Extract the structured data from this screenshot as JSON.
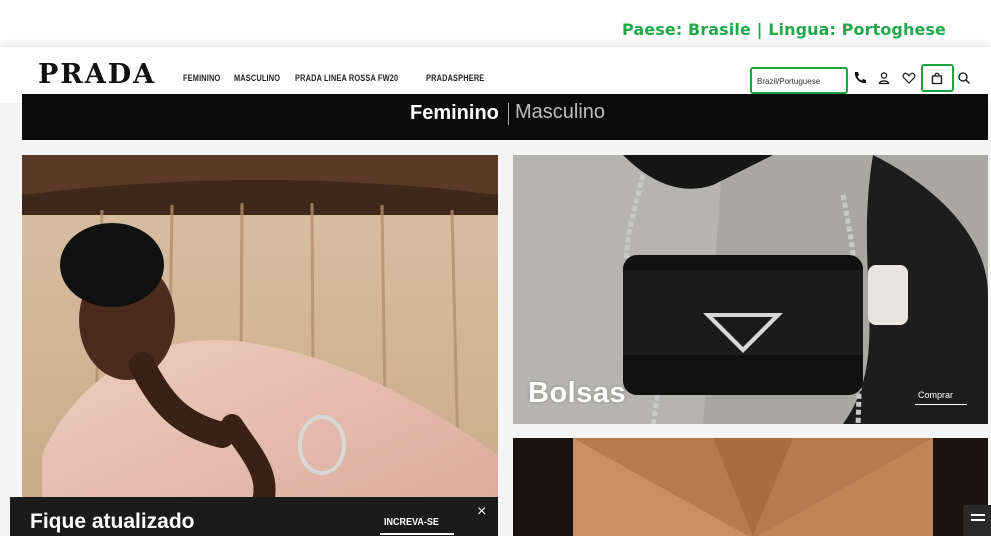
{
  "annotation": {
    "caption": "Paese: Brasile | Lingua: Portoghese",
    "highlight_color": "#1aa33f"
  },
  "header": {
    "logo": "PRADA",
    "nav": [
      "FEMININO",
      "MASCULINO",
      "PRADA LINEA ROSSA FW20",
      "PRADASPHERE"
    ],
    "region": "Brazil/Portuguese",
    "icons": [
      "phone-icon",
      "account-icon",
      "wishlist-heart-icon",
      "shopping-bag-icon",
      "search-icon"
    ]
  },
  "category_bar": {
    "active": "Feminino",
    "inactive": "Masculino"
  },
  "tiles": {
    "bags_label": "Bolsas",
    "bags_cta": "Comprar"
  },
  "newsletter": {
    "title": "Fique atualizado",
    "button": "INCREVA-SE",
    "close": "×"
  },
  "colors": {
    "accent_annotation": "#21a84a",
    "category_bar": "#0b0b0b",
    "newsletter_bg": "#1b1b1b"
  }
}
